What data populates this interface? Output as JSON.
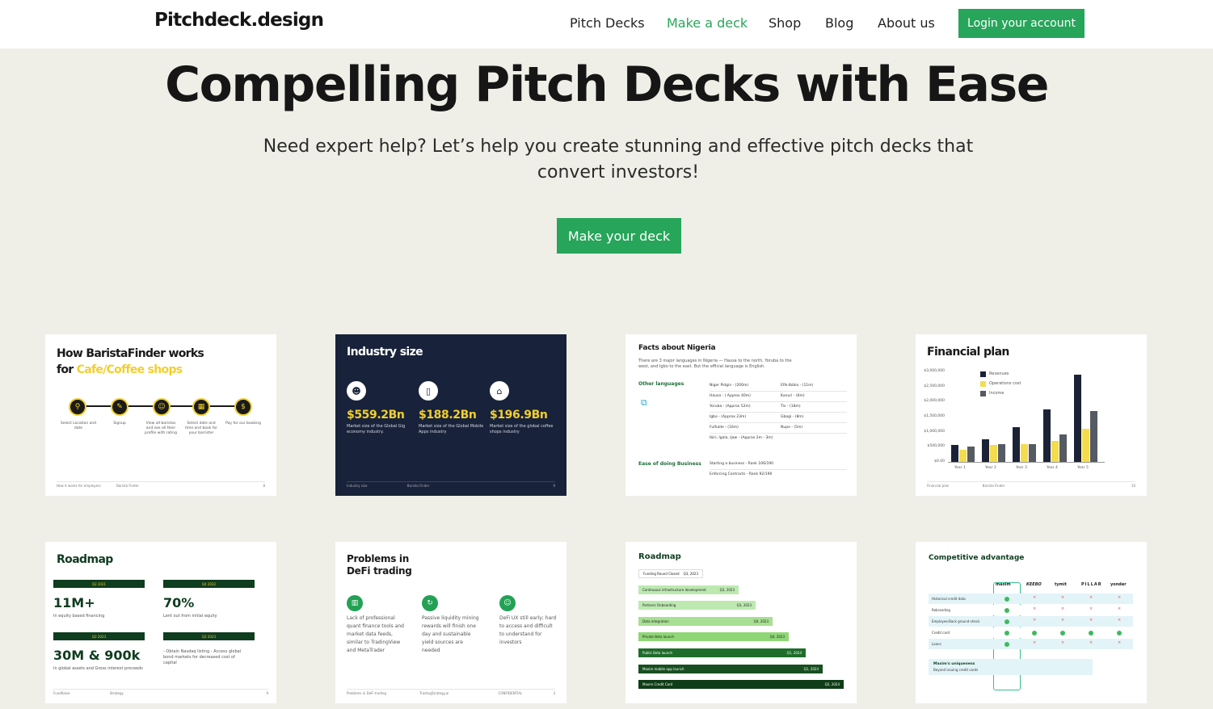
{
  "header": {
    "brand": "Pitchdeck.design",
    "nav": [
      "Pitch Decks",
      "Make a deck",
      "Shop",
      "Blog",
      "About us"
    ],
    "active_nav": "Make a deck",
    "login_label": "Login your account"
  },
  "hero": {
    "title": "Compelling Pitch Decks with Ease",
    "subtitle": "Need expert help? Let’s help you create stunning and effective pitch decks that convert investors!",
    "cta": "Make your deck"
  },
  "colors": {
    "accent": "#27a55a",
    "background": "#efefe7",
    "dark_slide": "#18223a",
    "yellow": "#f2cf2d"
  },
  "gallery": [
    {
      "title_line1": "How BaristaFinder works",
      "title_line2_prefix": "for ",
      "title_line2_highlight": "Cafe/Coffee shops",
      "steps": [
        "Select Location and date",
        "Signup",
        "View all baristas and see all their profile with rating",
        "Select date and time and book for your barrister",
        "Pay for our booking"
      ],
      "footer_left": "How it works for employers",
      "footer_mid": "Barista Finder",
      "footer_right": "8"
    },
    {
      "title": "Industry size",
      "stats": [
        {
          "value": "$559.2Bn",
          "desc": "Market size of the Global Gig economy industry."
        },
        {
          "value": "$188.2Bn",
          "desc": "Market size of the Global Mobile Apps industry"
        },
        {
          "value": "$196.9Bn",
          "desc": "Market size of the global coffee shops industry"
        }
      ],
      "footer_left": "Industry size",
      "footer_mid": "Barista Finder",
      "footer_right": "9"
    },
    {
      "title": "Facts about Nigeria",
      "intro": "There are 3 major languages in Nigeria — Hausa to the north, Yoruba to the west, and Igbo to the east. But the official language is English.",
      "section1": "Other languages",
      "languages_left": [
        "Niger Pidgin - (200m)",
        "Hausa - ( Approx 40m)",
        "Yoruba - (Approx 52m)",
        "Igbo - (Approx 23m)",
        "Fulfulde - (16m)",
        "Ibiri, Igala, Ijaw - (Approx 2m - 3m)"
      ],
      "languages_right": [
        "Efik-Ibibio - (11m)",
        "Kanuri - (6m)",
        "Tiv - (18m)",
        "Gbagi - (8m)",
        "Nupe - (5m)"
      ],
      "section2": "Ease of doing Business",
      "business": [
        "Starting a business - Rank 106/190",
        "Enforcing Contracts - Rank 92/190"
      ]
    },
    {
      "title": "Financial plan",
      "footer_left": "Financial plan",
      "footer_mid": "Barista Finder",
      "footer_right": "10"
    },
    {
      "title": "Roadmap",
      "blocks": [
        {
          "tag": "Q2 2021",
          "value": "11M+",
          "desc": "In equity based financing"
        },
        {
          "tag": "Q4 2022",
          "value": "70%",
          "desc": "Lent out from initial equity"
        },
        {
          "tag": "Q2 2023",
          "value": "30M & 900k",
          "desc": "In global assets and Gross interest proceeds"
        },
        {
          "tag": "Q2 2023",
          "value": "",
          "desc": "- Obtain Nasdaq listing  - Access global bond markets for decreased cost of capital"
        }
      ],
      "footer_left": "FundRaise",
      "footer_mid": "Strategy",
      "footer_right": "9"
    },
    {
      "title_line1": "Problems in",
      "title_line2": "DeFi trading",
      "problems": [
        "Lack of professional quant finance tools and market data feeds, similar to TradingView and MetaTrader",
        "Passive liquidity mining rewards will finish one day and sustainable yield sources are needed",
        "DeFi UX still early; hard to access and difficult to understand for investors"
      ],
      "footer_left": "Problems in DeFi trading",
      "footer_mid": "TradingStrategy.ai",
      "footer_conf": "CONFIDENTIAL",
      "footer_right": "3"
    },
    {
      "title": "Roadmap",
      "items": [
        {
          "label": "Funding Round Closed",
          "date": "Q3, 2023"
        },
        {
          "label": "Continuous infrastructure development",
          "date": "Q3, 2023"
        },
        {
          "label": "Partners Onboarding",
          "date": "Q3, 2023"
        },
        {
          "label": "Data integration",
          "date": "Q4, 2023"
        },
        {
          "label": "Private Beta launch",
          "date": "Q4, 2023"
        },
        {
          "label": "Public Beta launch",
          "date": "Q1, 2024"
        },
        {
          "label": "Maxim mobile app launch",
          "date": "Q1, 2024"
        },
        {
          "label": "Maxim Credit Card",
          "date": "Q2, 2024"
        }
      ]
    },
    {
      "title": "Competitive advantage",
      "competitors": [
        "maxim",
        "KEEBO",
        "tymit",
        "PILLAR",
        "yonder"
      ],
      "rows": [
        "Historical credit data",
        "Rebranding",
        "Employee-Back ground-check",
        "Credit card",
        "Loans"
      ],
      "note_title": "Maxim's uniqueness",
      "note": "Beyond issuing credit cards"
    }
  ],
  "chart_data": {
    "type": "bar",
    "title": "Financial plan",
    "categories": [
      "Year 1",
      "Year 2",
      "Year 3",
      "Year 4",
      "Year 5"
    ],
    "series": [
      {
        "name": "Revenues",
        "values": [
          550000,
          750000,
          1150000,
          1750000,
          2900000
        ]
      },
      {
        "name": "Operations cost",
        "values": [
          400000,
          550000,
          600000,
          700000,
          1100000
        ]
      },
      {
        "name": "Income",
        "values": [
          500000,
          600000,
          600000,
          900000,
          1700000
        ]
      }
    ],
    "yticks": [
      "$3,000,000",
      "$2,500,000",
      "$2,000,000",
      "$1,500,000",
      "$1,000,000",
      "$500,000",
      "$0.00"
    ],
    "ylim": [
      0,
      3000000
    ],
    "colors": [
      "#1b2236",
      "#f5dc4f",
      "#555a63"
    ],
    "legend": "top-left"
  }
}
